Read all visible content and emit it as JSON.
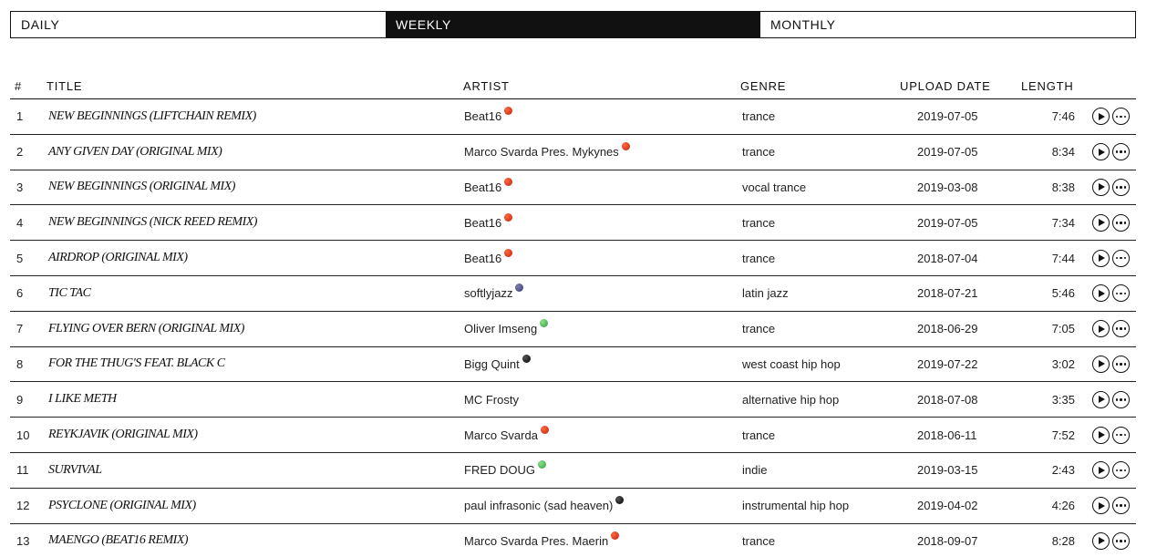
{
  "tabs": [
    {
      "label": "DAILY",
      "active": false
    },
    {
      "label": "WEEKLY",
      "active": true
    },
    {
      "label": "MONTHLY",
      "active": false
    }
  ],
  "columns": {
    "num": "#",
    "title": "TITLE",
    "artist": "ARTIST",
    "genre": "GENRE",
    "upload_date": "UPLOAD DATE",
    "length": "LENGTH"
  },
  "badge_colors": {
    "red": "#d9381e",
    "navy": "#3f4378",
    "green": "#3fb24a",
    "black": "#111111"
  },
  "rows": [
    {
      "num": "1",
      "title": "NEW BEGINNINGS (LIFTCHAIN REMIX)",
      "artist": "Beat16",
      "badge": "red",
      "genre": "trance",
      "date": "2019-07-05",
      "length": "7:46"
    },
    {
      "num": "2",
      "title": "ANY GIVEN DAY (ORIGINAL MIX)",
      "artist": "Marco Svarda Pres. Mykynes",
      "badge": "red",
      "genre": "trance",
      "date": "2019-07-05",
      "length": "8:34"
    },
    {
      "num": "3",
      "title": "NEW BEGINNINGS (ORIGINAL MIX)",
      "artist": "Beat16",
      "badge": "red",
      "genre": "vocal trance",
      "date": "2019-03-08",
      "length": "8:38"
    },
    {
      "num": "4",
      "title": "NEW BEGINNINGS (NICK REED REMIX)",
      "artist": "Beat16",
      "badge": "red",
      "genre": "trance",
      "date": "2019-07-05",
      "length": "7:34"
    },
    {
      "num": "5",
      "title": "AIRDROP (ORIGINAL MIX)",
      "artist": "Beat16",
      "badge": "red",
      "genre": "trance",
      "date": "2018-07-04",
      "length": "7:44"
    },
    {
      "num": "6",
      "title": "TIC TAC",
      "artist": "softlyjazz",
      "badge": "navy",
      "genre": "latin jazz",
      "date": "2018-07-21",
      "length": "5:46"
    },
    {
      "num": "7",
      "title": "FLYING OVER BERN (ORIGINAL MIX)",
      "artist": "Oliver Imseng",
      "badge": "green",
      "genre": "trance",
      "date": "2018-06-29",
      "length": "7:05"
    },
    {
      "num": "8",
      "title": "FOR THE THUG'S FEAT. BLACK C",
      "artist": "Bigg Quint",
      "badge": "black",
      "genre": "west coast hip hop",
      "date": "2019-07-22",
      "length": "3:02"
    },
    {
      "num": "9",
      "title": "I LIKE METH",
      "artist": "MC Frosty",
      "badge": "",
      "genre": "alternative hip hop",
      "date": "2018-07-08",
      "length": "3:35"
    },
    {
      "num": "10",
      "title": "REYKJAVIK (ORIGINAL MIX)",
      "artist": "Marco Svarda",
      "badge": "red",
      "genre": "trance",
      "date": "2018-06-11",
      "length": "7:52"
    },
    {
      "num": "11",
      "title": "SURVIVAL",
      "artist": "FRED DOUG",
      "badge": "green",
      "genre": "indie",
      "date": "2019-03-15",
      "length": "2:43"
    },
    {
      "num": "12",
      "title": "PSYCLONE (ORIGINAL MIX)",
      "artist": "paul infrasonic (sad heaven)",
      "badge": "black",
      "genre": "instrumental hip hop",
      "date": "2019-04-02",
      "length": "4:26"
    },
    {
      "num": "13",
      "title": "MAENGO (BEAT16 REMIX)",
      "artist": "Marco Svarda Pres. Maerin",
      "badge": "red",
      "genre": "trance",
      "date": "2018-09-07",
      "length": "8:28"
    }
  ],
  "icons": {
    "play": "play-icon",
    "more": "more-icon"
  }
}
